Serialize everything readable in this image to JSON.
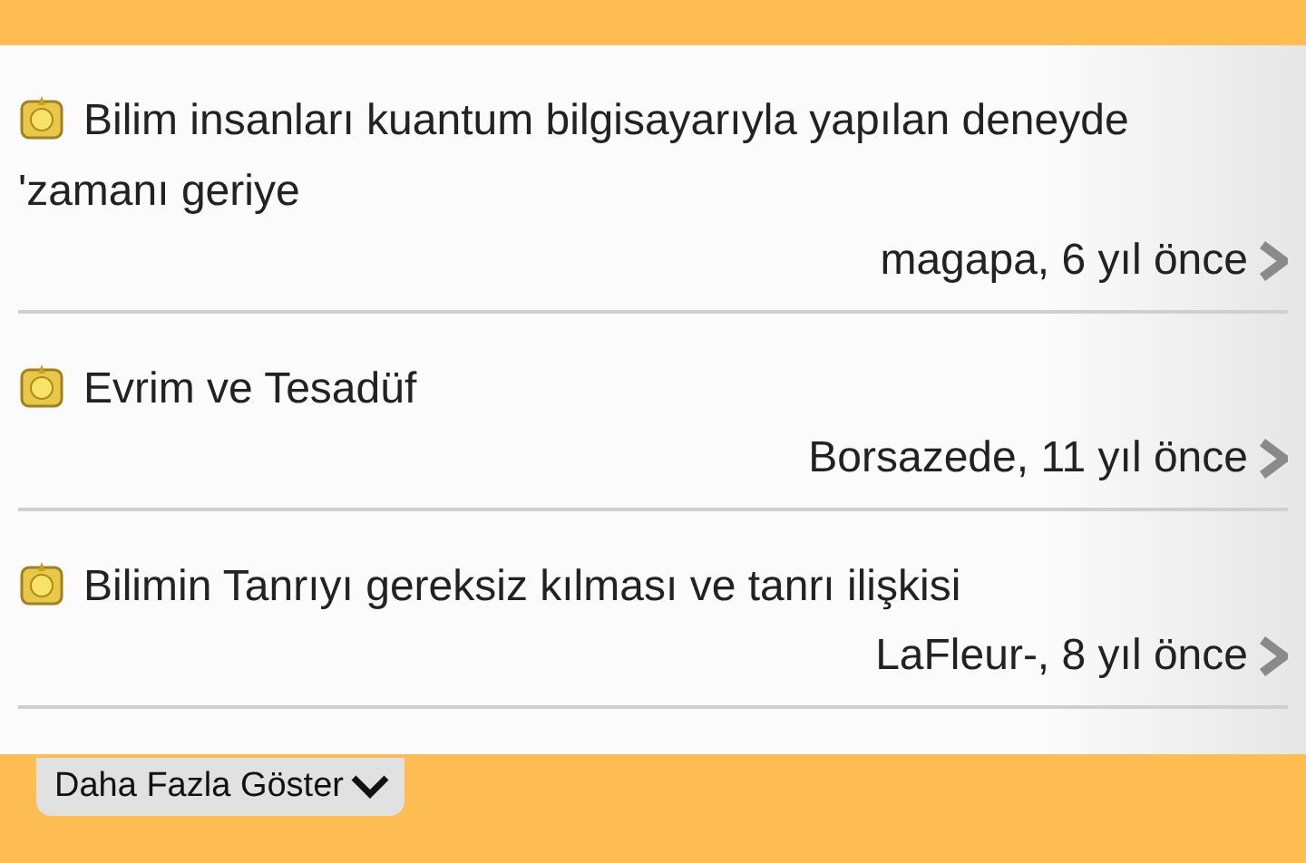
{
  "topics": [
    {
      "title": "Bilim insanları kuantum bilgisayarıyla yapılan deneyde 'zamanı geriye",
      "meta": "magapa, 6 yıl önce"
    },
    {
      "title": "Evrim ve Tesadüf",
      "meta": "Borsazede, 11 yıl önce"
    },
    {
      "title": "Bilimin Tanrıyı gereksiz kılması ve tanrı ilişkisi",
      "meta": "LaFleur-, 8 yıl önce"
    }
  ],
  "more_button": {
    "label": "Daha Fazla Göster"
  }
}
